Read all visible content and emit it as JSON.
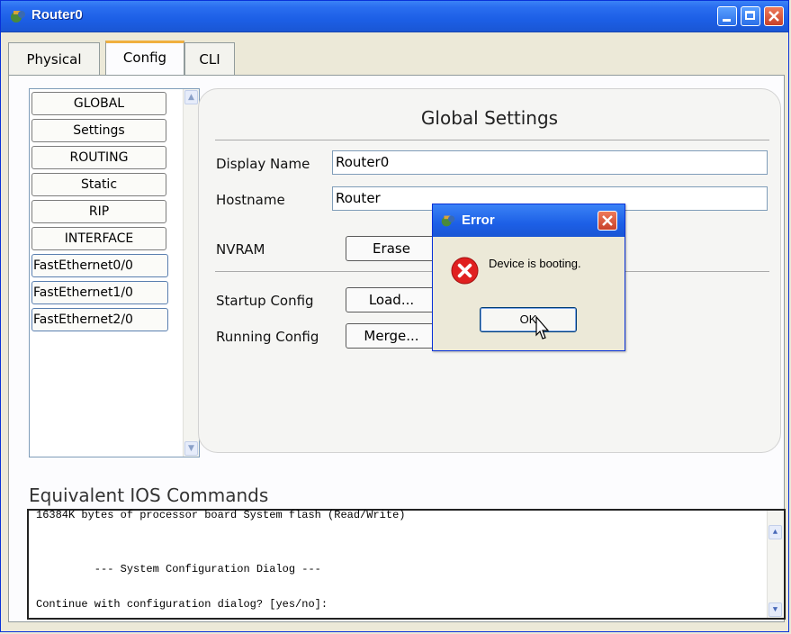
{
  "window": {
    "title": "Router0",
    "icon": "router-device-icon"
  },
  "tabs": [
    {
      "label": "Physical",
      "active": false
    },
    {
      "label": "Config",
      "active": true
    },
    {
      "label": "CLI",
      "active": false
    }
  ],
  "sidebar": {
    "items": [
      {
        "label": "GLOBAL"
      },
      {
        "label": "Settings"
      },
      {
        "label": "ROUTING"
      },
      {
        "label": "Static"
      },
      {
        "label": "RIP"
      },
      {
        "label": "INTERFACE"
      },
      {
        "label": "FastEthernet0/0"
      },
      {
        "label": "FastEthernet1/0"
      },
      {
        "label": "FastEthernet2/0"
      }
    ]
  },
  "global_settings": {
    "title": "Global Settings",
    "display_name_label": "Display Name",
    "display_name_value": "Router0",
    "hostname_label": "Hostname",
    "hostname_value": "Router",
    "nvram_label": "NVRAM",
    "erase_label": "Erase",
    "startup_label": "Startup Config",
    "load_label": "Load...",
    "running_label": "Running Config",
    "merge_label": "Merge..."
  },
  "ios": {
    "label": "Equivalent IOS Commands",
    "lines": [
      "16384K bytes of processor board System flash (Read/Write)",
      "",
      "",
      "         --- System Configuration Dialog ---",
      "",
      "Continue with configuration dialog? [yes/no]:"
    ]
  },
  "dialog": {
    "title": "Error",
    "message": "Device is booting.",
    "ok_label": "OK",
    "icon": "error-icon"
  },
  "colors": {
    "titlebar": "#1c5fe6",
    "close": "#c8412a",
    "error_red": "#e02020"
  }
}
